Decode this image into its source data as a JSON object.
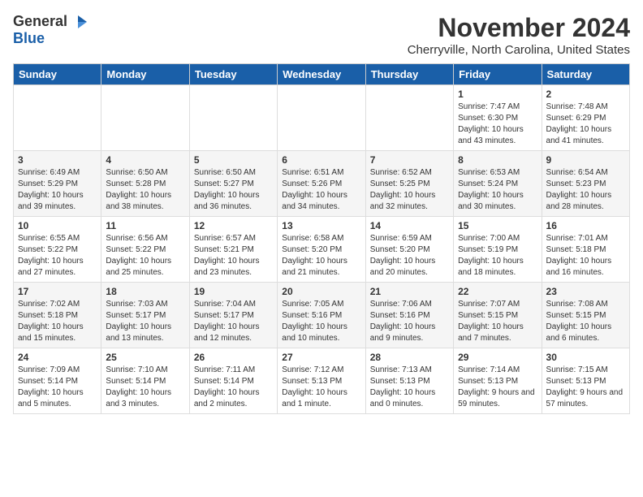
{
  "logo": {
    "general": "General",
    "blue": "Blue"
  },
  "title": "November 2024",
  "location": "Cherryville, North Carolina, United States",
  "days_of_week": [
    "Sunday",
    "Monday",
    "Tuesday",
    "Wednesday",
    "Thursday",
    "Friday",
    "Saturday"
  ],
  "weeks": [
    [
      {
        "day": "",
        "sunrise": "",
        "sunset": "",
        "daylight": ""
      },
      {
        "day": "",
        "sunrise": "",
        "sunset": "",
        "daylight": ""
      },
      {
        "day": "",
        "sunrise": "",
        "sunset": "",
        "daylight": ""
      },
      {
        "day": "",
        "sunrise": "",
        "sunset": "",
        "daylight": ""
      },
      {
        "day": "",
        "sunrise": "",
        "sunset": "",
        "daylight": ""
      },
      {
        "day": "1",
        "sunrise": "Sunrise: 7:47 AM",
        "sunset": "Sunset: 6:30 PM",
        "daylight": "Daylight: 10 hours and 43 minutes."
      },
      {
        "day": "2",
        "sunrise": "Sunrise: 7:48 AM",
        "sunset": "Sunset: 6:29 PM",
        "daylight": "Daylight: 10 hours and 41 minutes."
      }
    ],
    [
      {
        "day": "3",
        "sunrise": "Sunrise: 6:49 AM",
        "sunset": "Sunset: 5:29 PM",
        "daylight": "Daylight: 10 hours and 39 minutes."
      },
      {
        "day": "4",
        "sunrise": "Sunrise: 6:50 AM",
        "sunset": "Sunset: 5:28 PM",
        "daylight": "Daylight: 10 hours and 38 minutes."
      },
      {
        "day": "5",
        "sunrise": "Sunrise: 6:50 AM",
        "sunset": "Sunset: 5:27 PM",
        "daylight": "Daylight: 10 hours and 36 minutes."
      },
      {
        "day": "6",
        "sunrise": "Sunrise: 6:51 AM",
        "sunset": "Sunset: 5:26 PM",
        "daylight": "Daylight: 10 hours and 34 minutes."
      },
      {
        "day": "7",
        "sunrise": "Sunrise: 6:52 AM",
        "sunset": "Sunset: 5:25 PM",
        "daylight": "Daylight: 10 hours and 32 minutes."
      },
      {
        "day": "8",
        "sunrise": "Sunrise: 6:53 AM",
        "sunset": "Sunset: 5:24 PM",
        "daylight": "Daylight: 10 hours and 30 minutes."
      },
      {
        "day": "9",
        "sunrise": "Sunrise: 6:54 AM",
        "sunset": "Sunset: 5:23 PM",
        "daylight": "Daylight: 10 hours and 28 minutes."
      }
    ],
    [
      {
        "day": "10",
        "sunrise": "Sunrise: 6:55 AM",
        "sunset": "Sunset: 5:22 PM",
        "daylight": "Daylight: 10 hours and 27 minutes."
      },
      {
        "day": "11",
        "sunrise": "Sunrise: 6:56 AM",
        "sunset": "Sunset: 5:22 PM",
        "daylight": "Daylight: 10 hours and 25 minutes."
      },
      {
        "day": "12",
        "sunrise": "Sunrise: 6:57 AM",
        "sunset": "Sunset: 5:21 PM",
        "daylight": "Daylight: 10 hours and 23 minutes."
      },
      {
        "day": "13",
        "sunrise": "Sunrise: 6:58 AM",
        "sunset": "Sunset: 5:20 PM",
        "daylight": "Daylight: 10 hours and 21 minutes."
      },
      {
        "day": "14",
        "sunrise": "Sunrise: 6:59 AM",
        "sunset": "Sunset: 5:20 PM",
        "daylight": "Daylight: 10 hours and 20 minutes."
      },
      {
        "day": "15",
        "sunrise": "Sunrise: 7:00 AM",
        "sunset": "Sunset: 5:19 PM",
        "daylight": "Daylight: 10 hours and 18 minutes."
      },
      {
        "day": "16",
        "sunrise": "Sunrise: 7:01 AM",
        "sunset": "Sunset: 5:18 PM",
        "daylight": "Daylight: 10 hours and 16 minutes."
      }
    ],
    [
      {
        "day": "17",
        "sunrise": "Sunrise: 7:02 AM",
        "sunset": "Sunset: 5:18 PM",
        "daylight": "Daylight: 10 hours and 15 minutes."
      },
      {
        "day": "18",
        "sunrise": "Sunrise: 7:03 AM",
        "sunset": "Sunset: 5:17 PM",
        "daylight": "Daylight: 10 hours and 13 minutes."
      },
      {
        "day": "19",
        "sunrise": "Sunrise: 7:04 AM",
        "sunset": "Sunset: 5:17 PM",
        "daylight": "Daylight: 10 hours and 12 minutes."
      },
      {
        "day": "20",
        "sunrise": "Sunrise: 7:05 AM",
        "sunset": "Sunset: 5:16 PM",
        "daylight": "Daylight: 10 hours and 10 minutes."
      },
      {
        "day": "21",
        "sunrise": "Sunrise: 7:06 AM",
        "sunset": "Sunset: 5:16 PM",
        "daylight": "Daylight: 10 hours and 9 minutes."
      },
      {
        "day": "22",
        "sunrise": "Sunrise: 7:07 AM",
        "sunset": "Sunset: 5:15 PM",
        "daylight": "Daylight: 10 hours and 7 minutes."
      },
      {
        "day": "23",
        "sunrise": "Sunrise: 7:08 AM",
        "sunset": "Sunset: 5:15 PM",
        "daylight": "Daylight: 10 hours and 6 minutes."
      }
    ],
    [
      {
        "day": "24",
        "sunrise": "Sunrise: 7:09 AM",
        "sunset": "Sunset: 5:14 PM",
        "daylight": "Daylight: 10 hours and 5 minutes."
      },
      {
        "day": "25",
        "sunrise": "Sunrise: 7:10 AM",
        "sunset": "Sunset: 5:14 PM",
        "daylight": "Daylight: 10 hours and 3 minutes."
      },
      {
        "day": "26",
        "sunrise": "Sunrise: 7:11 AM",
        "sunset": "Sunset: 5:14 PM",
        "daylight": "Daylight: 10 hours and 2 minutes."
      },
      {
        "day": "27",
        "sunrise": "Sunrise: 7:12 AM",
        "sunset": "Sunset: 5:13 PM",
        "daylight": "Daylight: 10 hours and 1 minute."
      },
      {
        "day": "28",
        "sunrise": "Sunrise: 7:13 AM",
        "sunset": "Sunset: 5:13 PM",
        "daylight": "Daylight: 10 hours and 0 minutes."
      },
      {
        "day": "29",
        "sunrise": "Sunrise: 7:14 AM",
        "sunset": "Sunset: 5:13 PM",
        "daylight": "Daylight: 9 hours and 59 minutes."
      },
      {
        "day": "30",
        "sunrise": "Sunrise: 7:15 AM",
        "sunset": "Sunset: 5:13 PM",
        "daylight": "Daylight: 9 hours and 57 minutes."
      }
    ]
  ]
}
